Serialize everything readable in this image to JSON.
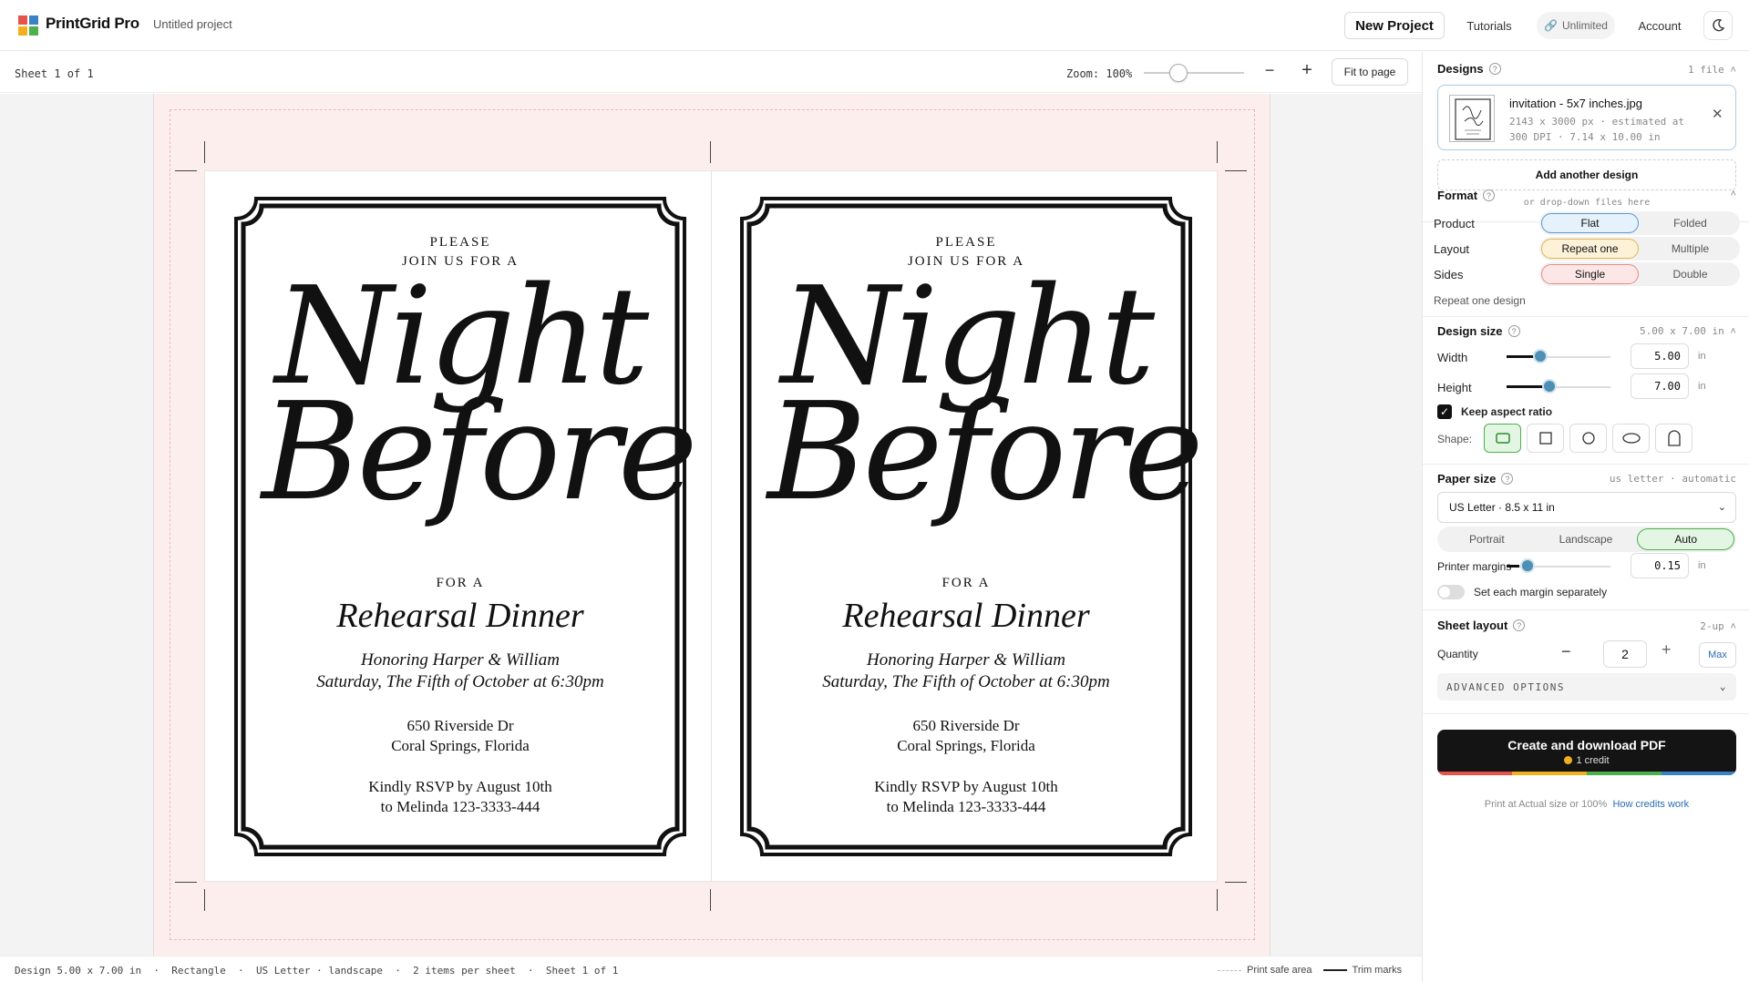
{
  "app": {
    "brand": "PrintGrid Pro",
    "project_name": "Untitled project"
  },
  "header": {
    "new_project": "New Project",
    "tutorials": "Tutorials",
    "unlimited": "Unlimited",
    "account": "Account"
  },
  "toolbar": {
    "sheet_label": "Sheet 1 of 1",
    "zoom_label": "Zoom: 100%",
    "zoom_percent": 100,
    "fit_label": "Fit to page"
  },
  "invitation": {
    "please": "PLEASE",
    "join": "JOIN US FOR A",
    "night": "Night",
    "before": "Before",
    "for_a": "FOR A",
    "event": "Rehearsal Dinner",
    "honoring": "Honoring Harper & William",
    "date": "Saturday, The Fifth of October at 6:30pm",
    "address1": "650 Riverside Dr",
    "address2": "Coral Springs, Florida",
    "rsvp1": "Kindly RSVP by August 10th",
    "rsvp2": "to Melinda 123-3333-444"
  },
  "status": {
    "design": "Design 5.00 x 7.00 in",
    "shape": "Rectangle",
    "paper": "US Letter · landscape",
    "items": "2 items per sheet",
    "sheet": "Sheet 1 of 1",
    "safe_area": "Print safe area",
    "trim_marks": "Trim marks"
  },
  "sidebar": {
    "designs": {
      "title": "Designs",
      "count": "1 file",
      "file_name": "invitation - 5x7 inches.jpg",
      "file_info_1": "2143 x 3000 px · estimated at",
      "file_info_2": "300 DPI · 7.14 x 10.00 in",
      "add_label": "Add another design",
      "drop_hint": "or drop-down files here"
    },
    "format": {
      "title": "Format",
      "product_label": "Product",
      "product_options": [
        "Flat",
        "Folded"
      ],
      "layout_label": "Layout",
      "layout_options": [
        "Repeat one",
        "Multiple"
      ],
      "sides_label": "Sides",
      "sides_options": [
        "Single",
        "Double"
      ],
      "hint": "Repeat one design"
    },
    "design_size": {
      "title": "Design size",
      "meta": "5.00 x 7.00 in",
      "width_label": "Width",
      "width_value": "5.00",
      "height_label": "Height",
      "height_value": "7.00",
      "unit": "in",
      "keep_aspect": "Keep aspect ratio",
      "shape_label": "Shape:"
    },
    "paper_size": {
      "title": "Paper size",
      "meta": "us letter · automatic",
      "selected": "US Letter · 8.5 x 11 in",
      "orientation_options": [
        "Portrait",
        "Landscape",
        "Auto"
      ],
      "margins_label": "Printer margins",
      "margins_value": "0.15",
      "unit": "in",
      "separate_label": "Set each margin separately"
    },
    "sheet_layout": {
      "title": "Sheet layout",
      "meta": "2-up",
      "quantity_label": "Quantity",
      "quantity_value": "2",
      "max_label": "Max",
      "advanced": "ADVANCED OPTIONS"
    },
    "cta": {
      "label": "Create and download PDF",
      "credit": "1 credit",
      "foot": "Print at Actual size or 100%",
      "foot_link": "How credits work"
    }
  },
  "colors": {
    "accent_blue": "#4f8fb4",
    "selected_green": "#4cb04c",
    "selected_yellow": "#e2b84f",
    "selected_pink": "#e48b8b"
  }
}
